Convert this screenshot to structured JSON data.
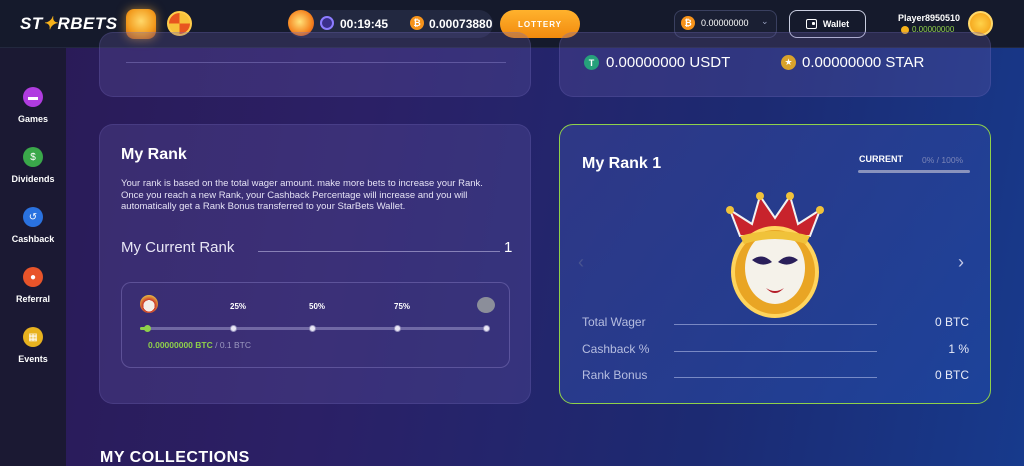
{
  "header": {
    "logo_prefix": "ST",
    "logo_star": "✦",
    "logo_suffix": "RBETS",
    "timer": "00:19:45",
    "jackpot": "0.00073880",
    "lottery_label": "LOTTERY",
    "balance": "0.00000000",
    "wallet_label": "Wallet",
    "player_name": "Player8950510",
    "player_balance": "0.00000000",
    "btc_symbol": "₿"
  },
  "sidebar": {
    "items": [
      {
        "label": "Games",
        "icon": "gamepad-icon",
        "color": "#b03ce0"
      },
      {
        "label": "Dividends",
        "icon": "money-bag-icon",
        "color": "#3aa84a"
      },
      {
        "label": "Cashback",
        "icon": "cashback-icon",
        "color": "#2a72e0"
      },
      {
        "label": "Referral",
        "icon": "referral-icon",
        "color": "#e8542a"
      },
      {
        "label": "Events",
        "icon": "calendar-icon",
        "color": "#e8b21f"
      }
    ]
  },
  "balances": {
    "usdt_symbol": "T",
    "usdt": "0.00000000 USDT",
    "star_symbol": "★",
    "star": "0.00000000 STAR"
  },
  "my_rank": {
    "title": "My Rank",
    "description": "Your rank is based on the total wager amount. make more bets to increase your Rank. Once you reach a new Rank, your Cashback Percentage will increase and you will automatically get a Rank Bonus transferred to your StarBets Wallet.",
    "current_rank_label": "My Current Rank",
    "current_rank_value": "1",
    "milestones": [
      "25%",
      "50%",
      "75%"
    ],
    "progress_fraction": 0.0,
    "wager_current": "0.00000000 BTC",
    "wager_target": " / 0.1 BTC"
  },
  "rank_card": {
    "title": "My Rank 1",
    "current_label": "CURRENT",
    "current_pct": "0% / 100%",
    "stats": [
      {
        "label": "Total Wager",
        "value": "0 BTC"
      },
      {
        "label": "Cashback %",
        "value": "1 %"
      },
      {
        "label": "Rank Bonus",
        "value": "0 BTC"
      }
    ]
  },
  "collections_title": "MY COLLECTIONS",
  "colors": {
    "accent_orange": "#f7b21b",
    "accent_green": "#8fd14a",
    "btc": "#f7931a",
    "usdt": "#26a17b"
  }
}
